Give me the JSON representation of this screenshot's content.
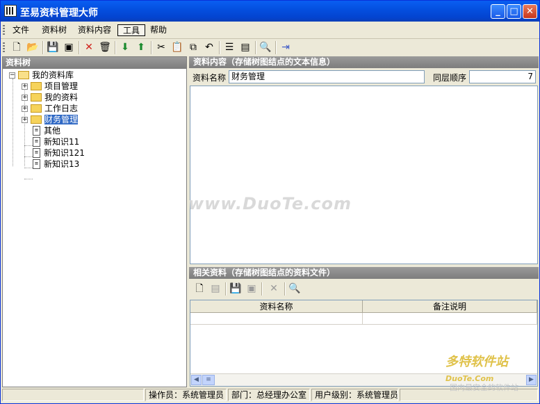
{
  "window": {
    "title": "至易资料管理大师"
  },
  "menu": {
    "items": [
      "文件",
      "资料树",
      "资料内容",
      "工具",
      "帮助"
    ],
    "active_index": 3
  },
  "left_pane": {
    "title": "资料树",
    "tree": {
      "root": "我的资料库",
      "folders": [
        "项目管理",
        "我的资料",
        "工作日志",
        "财务管理"
      ],
      "selected": "财务管理",
      "documents": [
        "其他",
        "新知识11",
        "新知识121",
        "新知识13"
      ]
    }
  },
  "content_panel": {
    "title": "资料内容（存储树图结点的文本信息）",
    "name_label": "资料名称",
    "name_value": "财务管理",
    "order_label": "同层顺序",
    "order_value": "7"
  },
  "related_panel": {
    "title": "相关资料（存储树图结点的资料文件）",
    "columns": [
      "资料名称",
      "备注说明"
    ]
  },
  "watermarks": {
    "center": "www.DuoTe.com",
    "logo": "多特软件站",
    "logo_url": "DuoTe.Com",
    "slogan": "国内最安全的软件站"
  },
  "status": {
    "operator": "操作员：系统管理员",
    "department": "部门：总经理办公室",
    "level": "用户级别：系统管理员"
  },
  "colors": {
    "title_bar": "#0a5ef2",
    "selection": "#316ac5",
    "panel_header": "#8a8a8a"
  }
}
